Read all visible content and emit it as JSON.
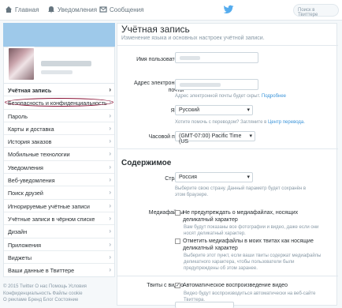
{
  "topbar": {
    "home": "Главная",
    "notifications": "Уведомления",
    "messages": "Сообщения",
    "search_placeholder": "Поиск в Твиттере"
  },
  "sidebar": {
    "items": [
      {
        "label": "Учётная запись",
        "active": true
      },
      {
        "label": "Безопасность и конфиденциальность",
        "active": false
      },
      {
        "label": "Пароль",
        "active": false
      },
      {
        "label": "Карты и доставка",
        "active": false
      },
      {
        "label": "История заказов",
        "active": false
      },
      {
        "label": "Мобильные технологии",
        "active": false
      },
      {
        "label": "Уведомления",
        "active": false
      },
      {
        "label": "Веб-уведомления",
        "active": false
      },
      {
        "label": "Поиск друзей",
        "active": false
      },
      {
        "label": "Игнорируемые учётные записи",
        "active": false
      },
      {
        "label": "Учётные записи в чёрном списке",
        "active": false
      },
      {
        "label": "Дизайн",
        "active": false
      },
      {
        "label": "Приложения",
        "active": false
      },
      {
        "label": "Виджеты",
        "active": false
      },
      {
        "label": "Ваши данные в Твиттере",
        "active": false
      }
    ]
  },
  "footer": {
    "line1": "© 2015 Twitter  О нас  Помощь  Условия",
    "line2": "Конфиденциальность  Файлы cookie",
    "line3": "О рекламе  Бренд  Блог  Состояние"
  },
  "main": {
    "title": "Учётная запись",
    "subtitle": "Изменение языка и основных настроек учётной записи.",
    "username_label": "Имя пользователя",
    "email_label": "Адрес электронной почты",
    "email_hint": "Адрес электронной почты будет скрыт.",
    "email_hint_link": "Подробнее",
    "language_label": "Язык",
    "language_value": "Русский",
    "language_hint": "Хотите помочь с переводом? Загляните в",
    "language_hint_link": "Центр перевода.",
    "timezone_label": "Часовой пояс",
    "timezone_value": "(GMT-07:00) Pacific Time (US",
    "content_heading": "Содержимое",
    "country_label": "Страна",
    "country_value": "Россия",
    "country_hint": "Выберите свою страну. Данный параметр будет сохранён в этом браузере.",
    "media_label": "Медиафайлы",
    "media_cb1": "Не предупреждать о медиафайлах, носящих деликатный характер",
    "media_hint1": "Вам будут показаны все фотографии и видео, даже если они носят деликатный характер.",
    "media_cb2": "Отметить медиафайлы в моих твитах как носящие деликатный характер",
    "media_hint2": "Выберите этот пункт, если ваши твиты содержат медиафайлы деликатного характера, чтобы пользователи были предупреждены об этом заранее.",
    "video_label": "Твиты с видео",
    "video_cb": "Автоматическое воспроизведение видео",
    "video_hint": "Видео будут воспроизводиться автоматически на веб-сайте Твиттера."
  },
  "colors": {
    "link": "#3b94d9",
    "banner": "#9ec9ea",
    "circle_annotation": "#8b1538"
  }
}
